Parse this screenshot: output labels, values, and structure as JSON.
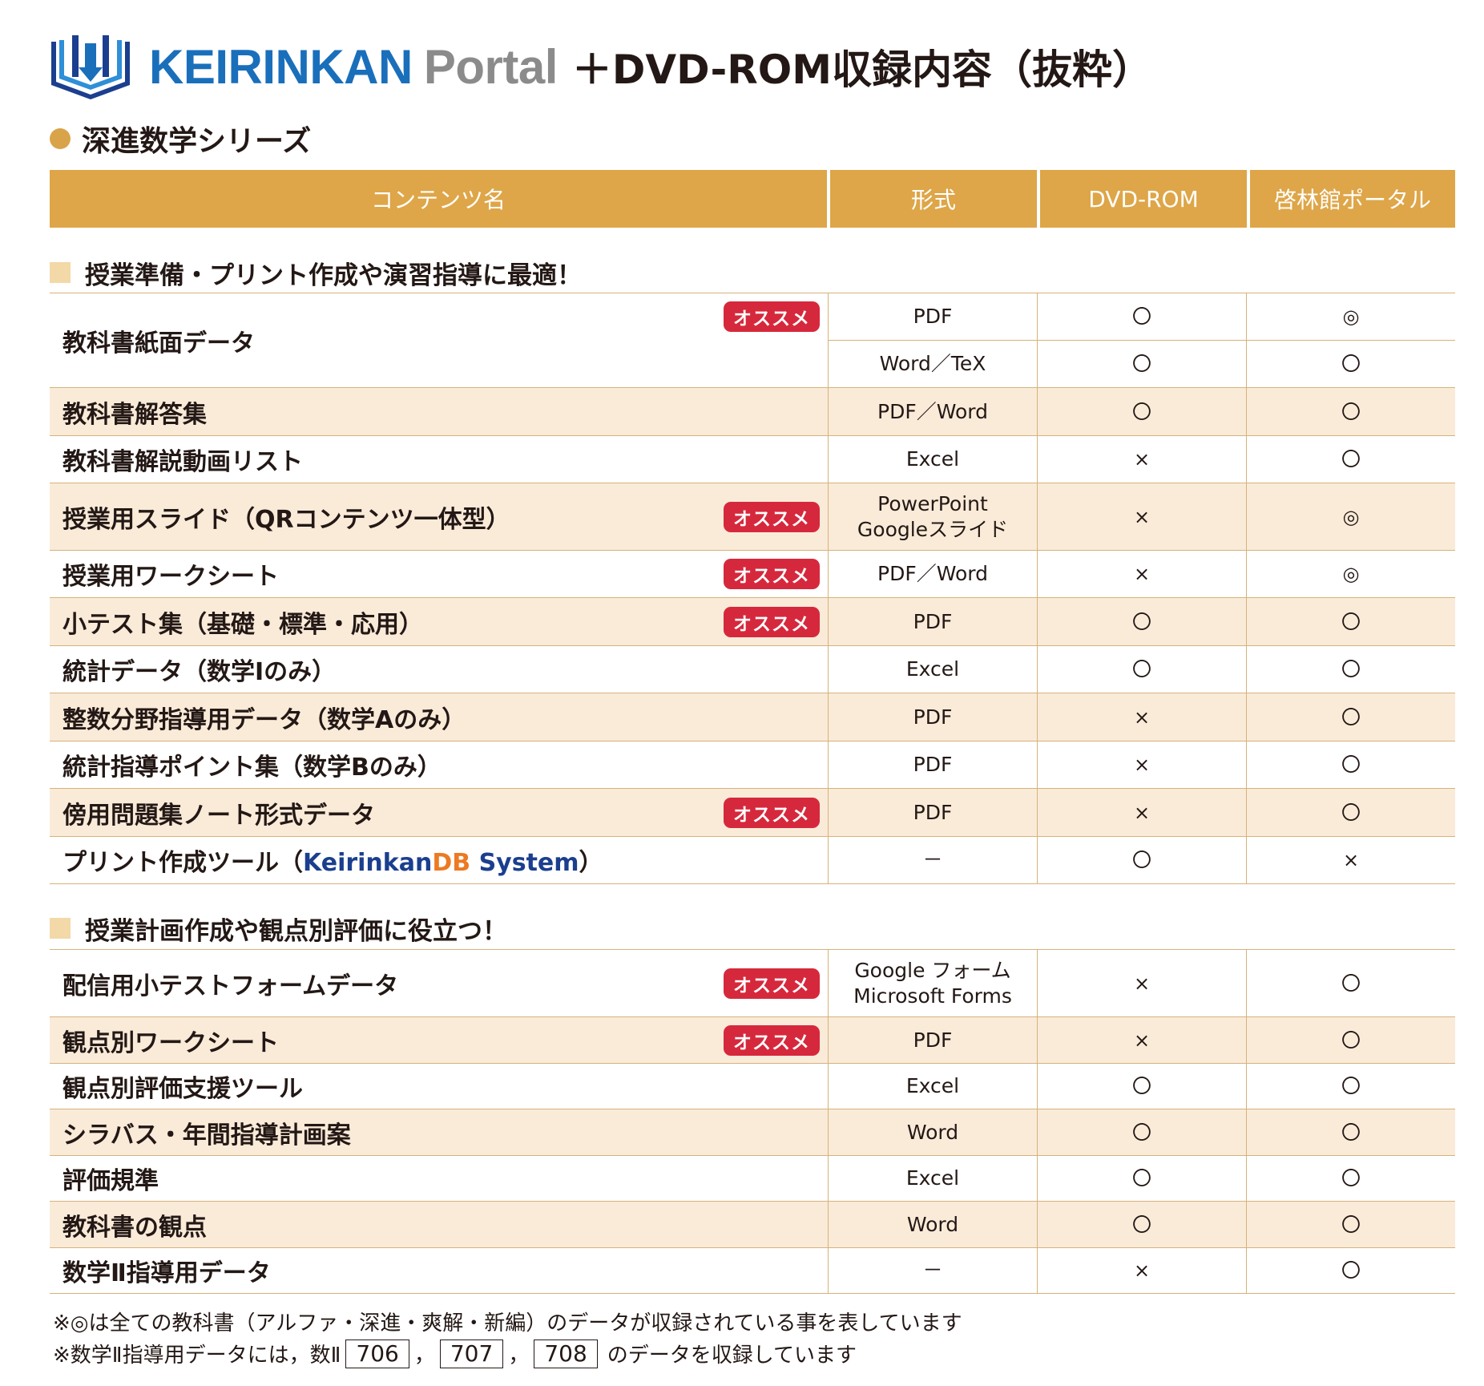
{
  "header": {
    "brand_main": "KEIRINKAN",
    "brand_sub": "Portal",
    "title_suffix": "＋DVD-ROM収録内容（抜粋）"
  },
  "series": {
    "title": "深進数学シリーズ"
  },
  "columns": {
    "name": "コンテンツ名",
    "format": "形式",
    "dvd": "DVD-ROM",
    "portal": "啓林館ポータル"
  },
  "badge_label": "オススメ",
  "section1": {
    "title": "授業準備・プリント作成や演習指導に最適！",
    "rows": [
      {
        "name": "教科書紙面データ",
        "badge": true,
        "subs": [
          {
            "format": "PDF",
            "dvd": "〇",
            "portal": "◎"
          },
          {
            "format": "Word／TeX",
            "dvd": "〇",
            "portal": "〇"
          }
        ]
      },
      {
        "name": "教科書解答集",
        "format": "PDF／Word",
        "dvd": "〇",
        "portal": "〇"
      },
      {
        "name": "教科書解説動画リスト",
        "format": "Excel",
        "dvd": "×",
        "portal": "〇"
      },
      {
        "name": "授業用スライド（QRコンテンツ一体型）",
        "badge": true,
        "format_line1": "PowerPoint",
        "format_line2": "Googleスライド",
        "dvd": "×",
        "portal": "◎"
      },
      {
        "name": "授業用ワークシート",
        "badge": true,
        "format": "PDF／Word",
        "dvd": "×",
        "portal": "◎"
      },
      {
        "name": "小テスト集（基礎・標準・応用）",
        "badge": true,
        "format": "PDF",
        "dvd": "〇",
        "portal": "〇"
      },
      {
        "name": "統計データ（数学Ⅰのみ）",
        "format": "Excel",
        "dvd": "〇",
        "portal": "〇"
      },
      {
        "name": "整数分野指導用データ（数学Aのみ）",
        "format": "PDF",
        "dvd": "×",
        "portal": "〇"
      },
      {
        "name": "統計指導ポイント集（数学Bのみ）",
        "format": "PDF",
        "dvd": "×",
        "portal": "〇"
      },
      {
        "name": "傍用問題集ノート形式データ",
        "badge": true,
        "format": "PDF",
        "dvd": "×",
        "portal": "〇"
      },
      {
        "name_prefix": "プリント作成ツール（",
        "name_k": "Keirinkan",
        "name_d": "DB",
        "name_s": " System",
        "name_suffix": "）",
        "format": "－",
        "dvd": "〇",
        "portal": "×"
      }
    ]
  },
  "section2": {
    "title": "授業計画作成や観点別評価に役立つ！",
    "rows": [
      {
        "name": "配信用小テストフォームデータ",
        "badge": true,
        "format_line1": "Google フォーム",
        "format_line2": "Microsoft Forms",
        "dvd": "×",
        "portal": "〇"
      },
      {
        "name": "観点別ワークシート",
        "badge": true,
        "format": "PDF",
        "dvd": "×",
        "portal": "〇"
      },
      {
        "name": "観点別評価支援ツール",
        "format": "Excel",
        "dvd": "〇",
        "portal": "〇"
      },
      {
        "name": "シラバス・年間指導計画案",
        "format": "Word",
        "dvd": "〇",
        "portal": "〇"
      },
      {
        "name": "評価規準",
        "format": "Excel",
        "dvd": "〇",
        "portal": "〇"
      },
      {
        "name": "教科書の観点",
        "format": "Word",
        "dvd": "〇",
        "portal": "〇"
      },
      {
        "name": "数学Ⅱ指導用データ",
        "format": "－",
        "dvd": "×",
        "portal": "〇"
      }
    ]
  },
  "notes": {
    "line1": "※◎は全ての教科書（アルファ・深進・爽解・新編）のデータが収録されている事を表しています",
    "line2_prefix": "※数学Ⅱ指導用データには，数Ⅱ",
    "box1": "706",
    "sep1": "，",
    "box2": "707",
    "sep2": "，",
    "box3": "708",
    "line2_suffix": "のデータを収録しています"
  },
  "colors": {
    "brand_blue": "#1a6fbb",
    "header_gold": "#dea648",
    "row_shade": "#faebd9",
    "badge_red": "#d6283c"
  }
}
